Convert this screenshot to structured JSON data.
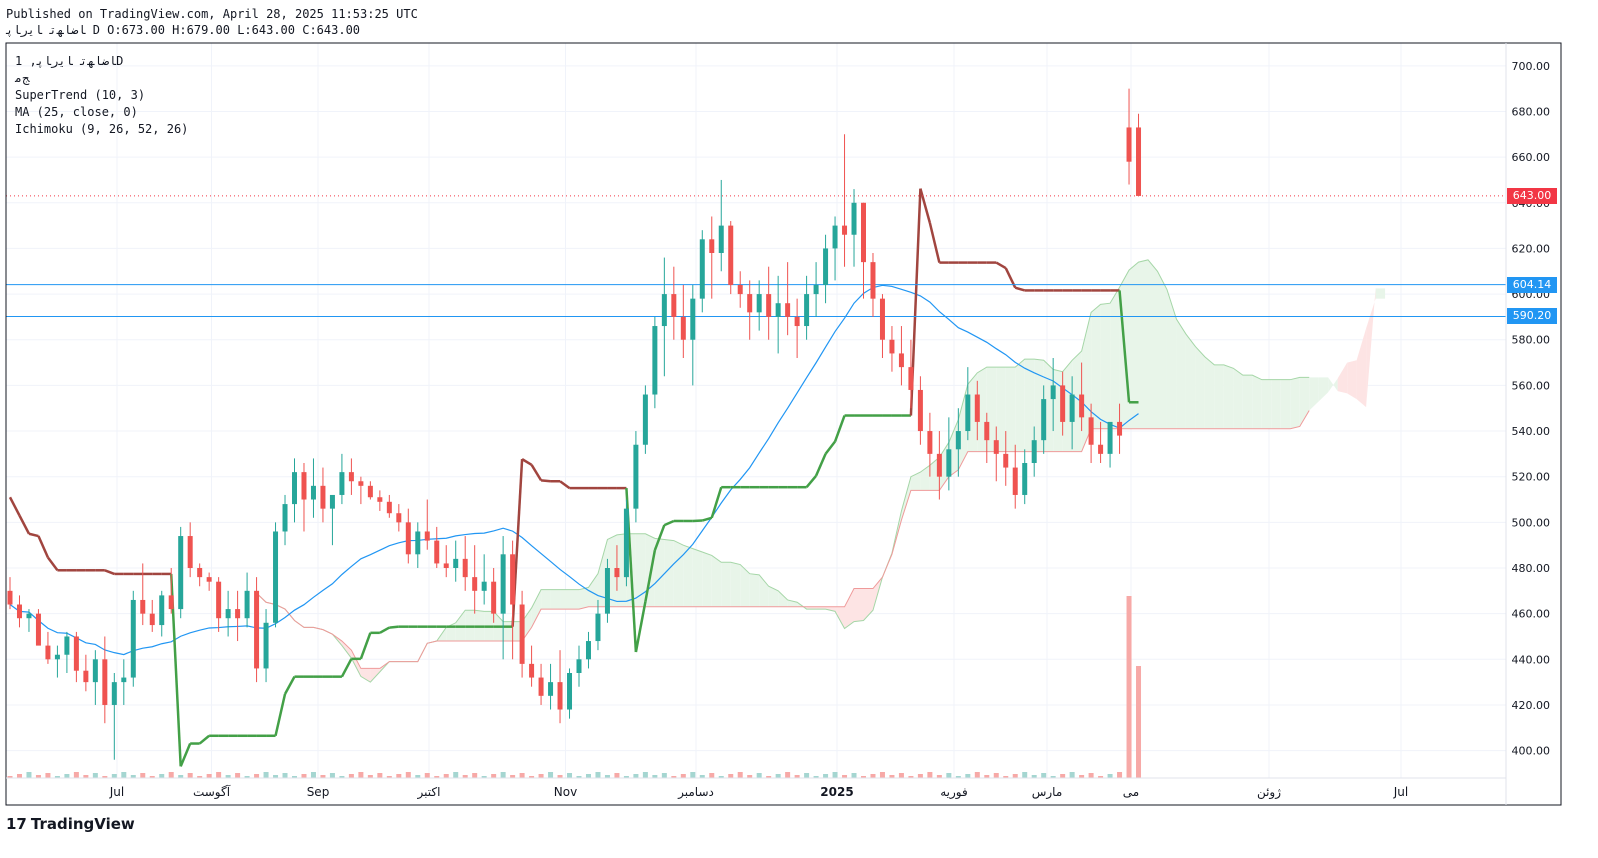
{
  "header": {
    "published": "Published on TradingView.com, April 28, 2025 11:53:25 UTC",
    "ohlc": "ﺎﺿﺎﻬﺗ ﺎﻳﺭﺎﭘ D O:673.00 H:679.00 L:643.00 C:643.00"
  },
  "legend": {
    "symbol": "ﺎﺿﺎﻬﺗ ﺎﻳﺭﺎﭘ, 1D",
    "ticker": "ﺞﻣ",
    "supertrend": "SuperTrend (10, 3)",
    "ma": "MA (25, close, 0)",
    "ichimoku": "Ichimoku (9, 26, 52, 26)"
  },
  "price_tags": [
    {
      "label": "643.00",
      "value": 643,
      "color": "#f23645"
    },
    {
      "label": "604.14",
      "value": 604.14,
      "color": "#2196f3"
    },
    {
      "label": "590.20",
      "value": 590.2,
      "color": "#2196f3"
    }
  ],
  "logo": {
    "text": "TradingView",
    "mark": "17"
  },
  "colors": {
    "up": "#26a69a",
    "down": "#ef5350",
    "supertrend_up": "#43a047",
    "supertrend_down": "#a1453f",
    "ma": "#2196f3",
    "kumo_bull": "#e8f5e9",
    "kumo_bear": "#fde4e4"
  },
  "chart_data": {
    "type": "candlestick",
    "title": "",
    "ylim": [
      388,
      710
    ],
    "y_ticks": [
      "400.00",
      "420.00",
      "440.00",
      "460.00",
      "480.00",
      "500.00",
      "520.00",
      "540.00",
      "560.00",
      "580.00",
      "600.00",
      "620.00",
      "640.00",
      "660.00",
      "680.00",
      "700.00"
    ],
    "x_labels": [
      "Jul",
      "آگوست",
      "Sep",
      "اکتبر",
      "Nov",
      "دسامبر",
      "2025",
      "فوریه",
      "مارس",
      "می",
      "ژوئن",
      "Jul"
    ],
    "candles": [
      [
        470,
        476,
        462,
        464
      ],
      [
        464,
        468,
        454,
        458
      ],
      [
        458,
        462,
        452,
        460
      ],
      [
        460,
        462,
        448,
        446
      ],
      [
        446,
        452,
        438,
        440
      ],
      [
        440,
        446,
        432,
        442
      ],
      [
        442,
        452,
        434,
        450
      ],
      [
        450,
        452,
        430,
        435
      ],
      [
        435,
        442,
        426,
        430
      ],
      [
        430,
        444,
        420,
        440
      ],
      [
        440,
        450,
        412,
        420
      ],
      [
        420,
        434,
        396,
        430
      ],
      [
        430,
        440,
        420,
        432
      ],
      [
        432,
        470,
        428,
        466
      ],
      [
        466,
        482,
        455,
        460
      ],
      [
        460,
        466,
        452,
        455
      ],
      [
        455,
        470,
        450,
        468
      ],
      [
        468,
        480,
        460,
        462
      ],
      [
        462,
        498,
        458,
        494
      ],
      [
        494,
        500,
        476,
        480
      ],
      [
        480,
        482,
        472,
        476
      ],
      [
        476,
        478,
        470,
        474
      ],
      [
        474,
        476,
        452,
        458
      ],
      [
        458,
        470,
        450,
        462
      ],
      [
        462,
        470,
        448,
        458
      ],
      [
        458,
        478,
        454,
        470
      ],
      [
        470,
        476,
        430,
        436
      ],
      [
        436,
        462,
        430,
        456
      ],
      [
        456,
        500,
        454,
        496
      ],
      [
        496,
        512,
        490,
        508
      ],
      [
        508,
        528,
        500,
        522
      ],
      [
        522,
        526,
        496,
        510
      ],
      [
        510,
        528,
        502,
        516
      ],
      [
        516,
        524,
        500,
        506
      ],
      [
        506,
        510,
        490,
        512
      ],
      [
        512,
        530,
        508,
        522
      ],
      [
        522,
        528,
        512,
        518
      ],
      [
        518,
        520,
        508,
        516
      ],
      [
        516,
        518,
        510,
        511
      ],
      [
        511,
        514,
        505,
        509
      ],
      [
        509,
        512,
        502,
        504
      ],
      [
        504,
        508,
        496,
        500
      ],
      [
        500,
        506,
        482,
        486
      ],
      [
        486,
        500,
        480,
        496
      ],
      [
        496,
        510,
        488,
        492
      ],
      [
        492,
        498,
        480,
        482
      ],
      [
        482,
        490,
        476,
        480
      ],
      [
        480,
        492,
        474,
        484
      ],
      [
        484,
        494,
        470,
        476
      ],
      [
        476,
        490,
        460,
        470
      ],
      [
        470,
        486,
        464,
        474
      ],
      [
        474,
        480,
        456,
        460
      ],
      [
        460,
        494,
        440,
        486
      ],
      [
        486,
        492,
        440,
        464
      ],
      [
        464,
        470,
        432,
        438
      ],
      [
        438,
        446,
        428,
        432
      ],
      [
        432,
        438,
        420,
        424
      ],
      [
        424,
        438,
        418,
        430
      ],
      [
        430,
        444,
        412,
        418
      ],
      [
        418,
        436,
        414,
        434
      ],
      [
        434,
        446,
        428,
        440
      ],
      [
        440,
        452,
        436,
        448
      ],
      [
        448,
        466,
        444,
        460
      ],
      [
        460,
        484,
        456,
        480
      ],
      [
        480,
        490,
        470,
        476
      ],
      [
        476,
        510,
        472,
        506
      ],
      [
        506,
        540,
        500,
        534
      ],
      [
        534,
        560,
        530,
        556
      ],
      [
        556,
        590,
        550,
        586
      ],
      [
        586,
        616,
        564,
        600
      ],
      [
        600,
        612,
        580,
        590
      ],
      [
        590,
        604,
        572,
        580
      ],
      [
        580,
        604,
        560,
        598
      ],
      [
        598,
        628,
        592,
        624
      ],
      [
        624,
        634,
        598,
        618
      ],
      [
        618,
        650,
        610,
        630
      ],
      [
        630,
        632,
        600,
        604
      ],
      [
        604,
        610,
        594,
        600
      ],
      [
        600,
        606,
        580,
        592
      ],
      [
        592,
        606,
        584,
        600
      ],
      [
        600,
        612,
        580,
        590
      ],
      [
        590,
        608,
        574,
        596
      ],
      [
        596,
        614,
        582,
        590
      ],
      [
        590,
        598,
        572,
        586
      ],
      [
        586,
        608,
        580,
        600
      ],
      [
        600,
        614,
        590,
        604
      ],
      [
        604,
        626,
        596,
        620
      ],
      [
        620,
        634,
        606,
        630
      ],
      [
        630,
        670,
        612,
        626
      ],
      [
        626,
        646,
        612,
        640
      ],
      [
        640,
        640,
        598,
        614
      ],
      [
        614,
        618,
        590,
        598
      ],
      [
        598,
        600,
        572,
        580
      ],
      [
        580,
        586,
        566,
        574
      ],
      [
        574,
        586,
        560,
        568
      ],
      [
        568,
        580,
        550,
        558
      ],
      [
        558,
        564,
        534,
        540
      ],
      [
        540,
        548,
        520,
        530
      ],
      [
        530,
        540,
        510,
        520
      ],
      [
        520,
        546,
        514,
        532
      ],
      [
        532,
        550,
        520,
        540
      ],
      [
        540,
        568,
        536,
        556
      ],
      [
        556,
        562,
        536,
        544
      ],
      [
        544,
        548,
        526,
        536
      ],
      [
        536,
        542,
        518,
        530
      ],
      [
        530,
        540,
        516,
        524
      ],
      [
        524,
        534,
        506,
        512
      ],
      [
        512,
        532,
        508,
        526
      ],
      [
        526,
        542,
        520,
        536
      ],
      [
        536,
        560,
        530,
        554
      ],
      [
        554,
        572,
        540,
        560
      ],
      [
        560,
        566,
        538,
        544
      ],
      [
        544,
        564,
        532,
        556
      ],
      [
        556,
        570,
        540,
        546
      ],
      [
        546,
        552,
        526,
        534
      ],
      [
        534,
        544,
        526,
        530
      ],
      [
        530,
        542,
        524,
        544
      ],
      [
        544,
        552,
        530,
        538
      ],
      [
        673,
        690,
        648,
        658
      ],
      [
        673,
        679,
        643,
        643
      ]
    ]
  }
}
